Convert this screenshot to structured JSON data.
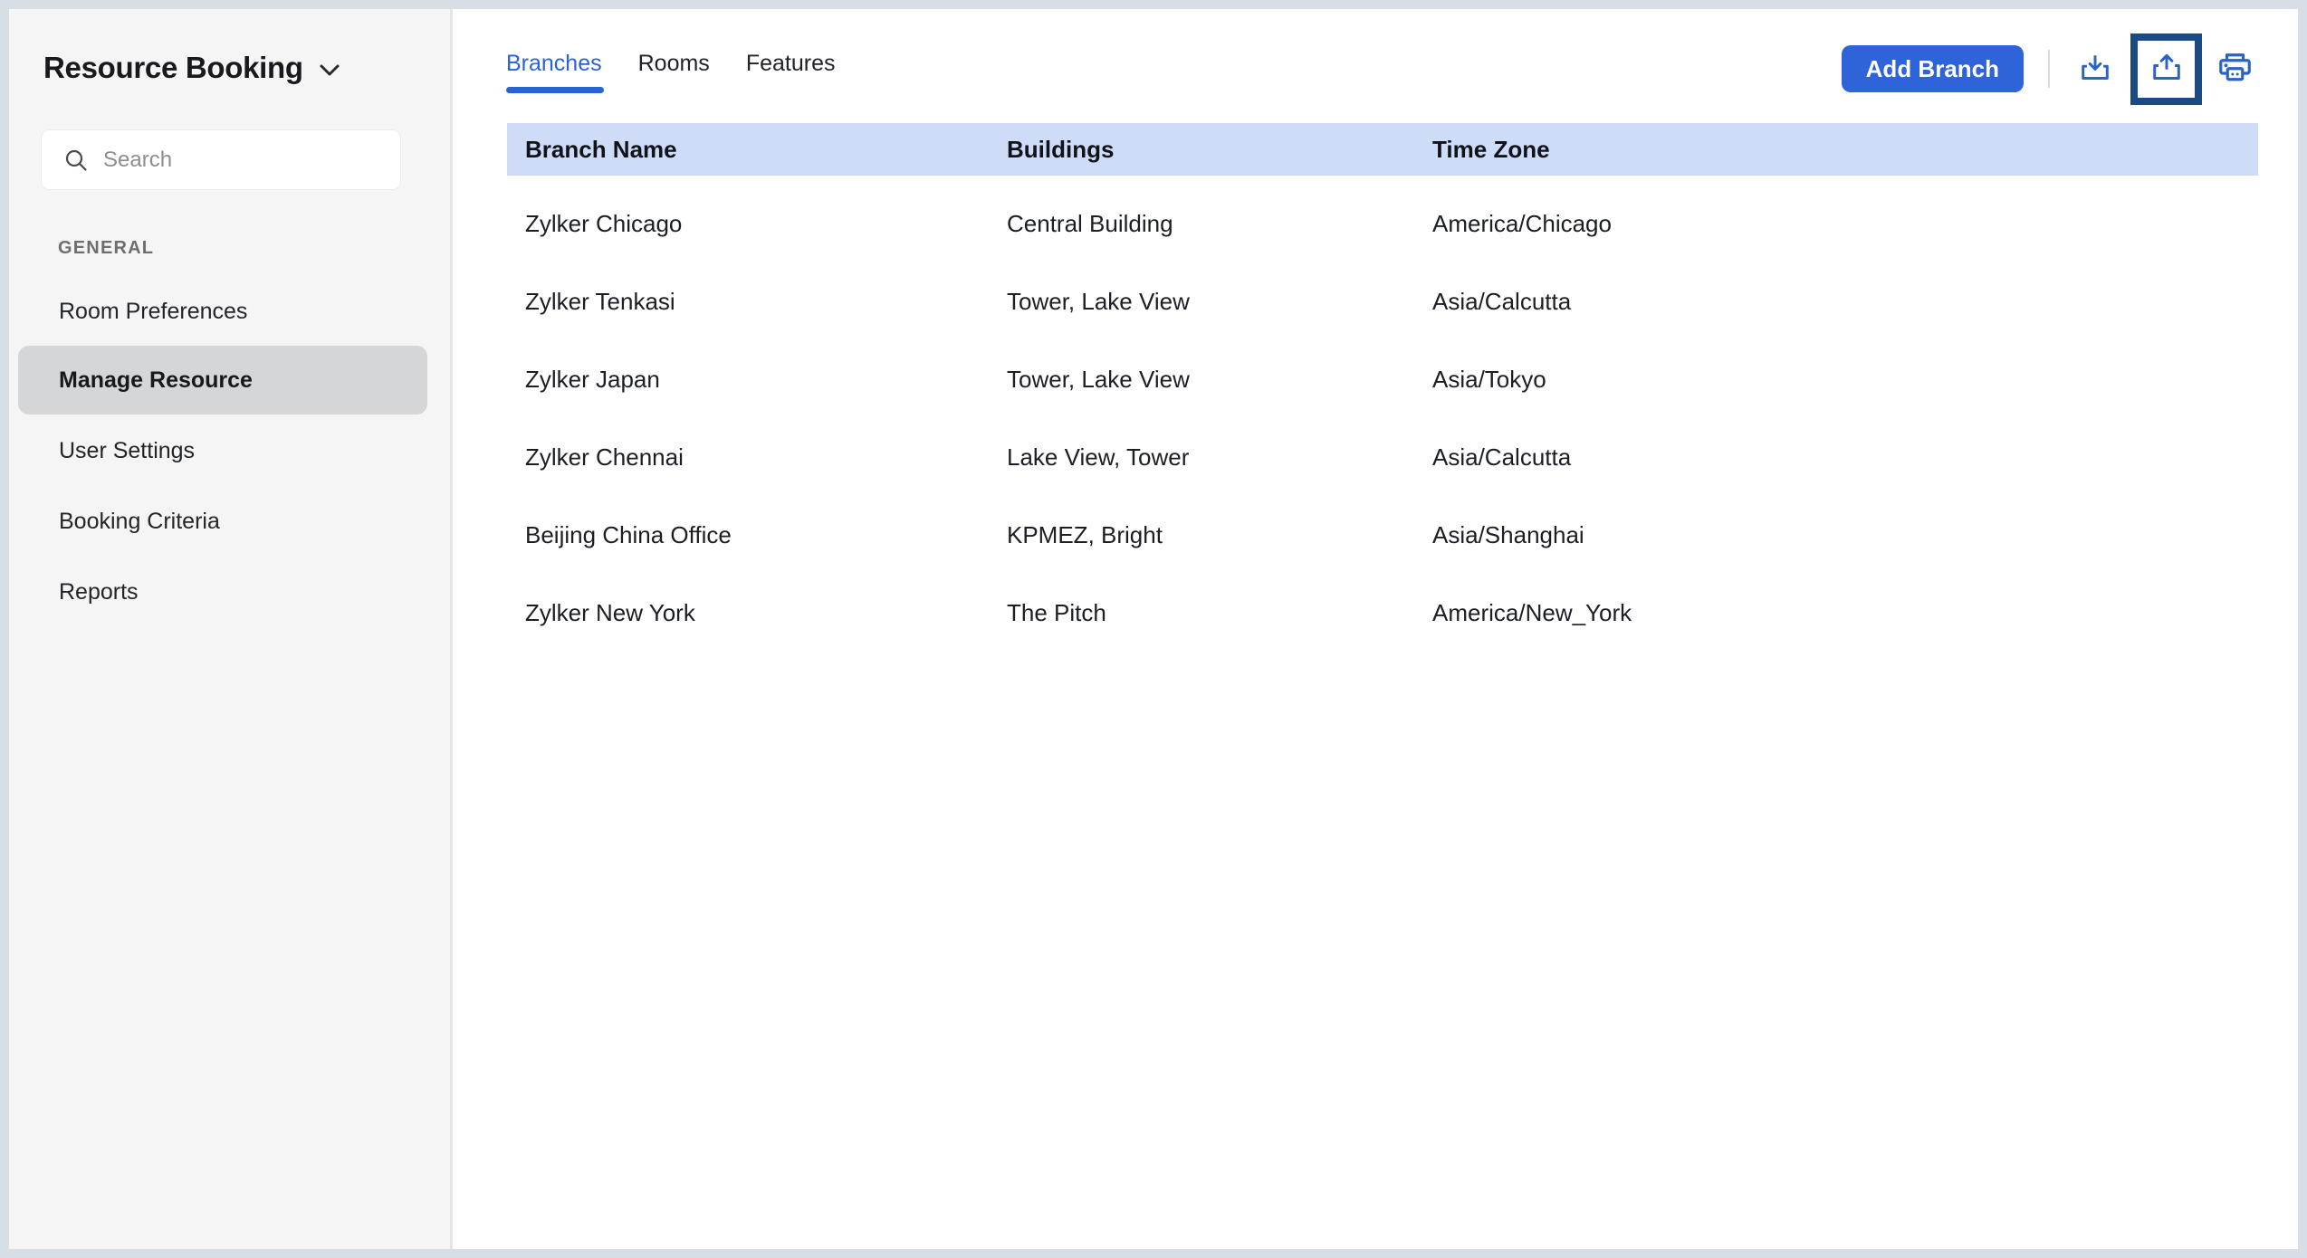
{
  "app": {
    "title": "Resource Booking"
  },
  "sidebar": {
    "search_placeholder": "Search",
    "section_label": "GENERAL",
    "items": [
      {
        "label": "Room Preferences",
        "selected": false
      },
      {
        "label": "Manage Resource",
        "selected": true
      },
      {
        "label": "User Settings",
        "selected": false
      },
      {
        "label": "Booking Criteria",
        "selected": false
      },
      {
        "label": "Reports",
        "selected": false
      }
    ]
  },
  "main": {
    "tabs": [
      {
        "label": "Branches",
        "active": true
      },
      {
        "label": "Rooms",
        "active": false
      },
      {
        "label": "Features",
        "active": false
      }
    ],
    "toolbar": {
      "add_branch_label": "Add Branch",
      "icons": [
        {
          "name": "import-icon"
        },
        {
          "name": "export-icon",
          "highlighted": true
        },
        {
          "name": "print-icon"
        }
      ]
    },
    "table": {
      "columns": [
        "Branch Name",
        "Buildings",
        "Time Zone"
      ],
      "rows": [
        [
          "Zylker Chicago",
          "Central Building",
          "America/Chicago"
        ],
        [
          "Zylker Tenkasi",
          "Tower, Lake View",
          "Asia/Calcutta"
        ],
        [
          "Zylker Japan",
          "Tower, Lake View",
          "Asia/Tokyo"
        ],
        [
          "Zylker Chennai",
          "Lake View, Tower",
          "Asia/Calcutta"
        ],
        [
          "Beijing China Office",
          "KPMEZ, Bright",
          "Asia/Shanghai"
        ],
        [
          "Zylker New York",
          "The Pitch",
          "America/New_York"
        ]
      ]
    }
  },
  "colors": {
    "page_border": "#d7dee4",
    "sidebar_bg": "#f5f5f6",
    "selected_bg": "#d5d6d8",
    "accent_blue": "#2a63d8",
    "button_blue": "#2e63da",
    "icon_blue": "#2b62c6",
    "highlight_navy": "#1c4b84",
    "header_bg": "#cedcf8",
    "text_dark": "#1b1e24"
  }
}
